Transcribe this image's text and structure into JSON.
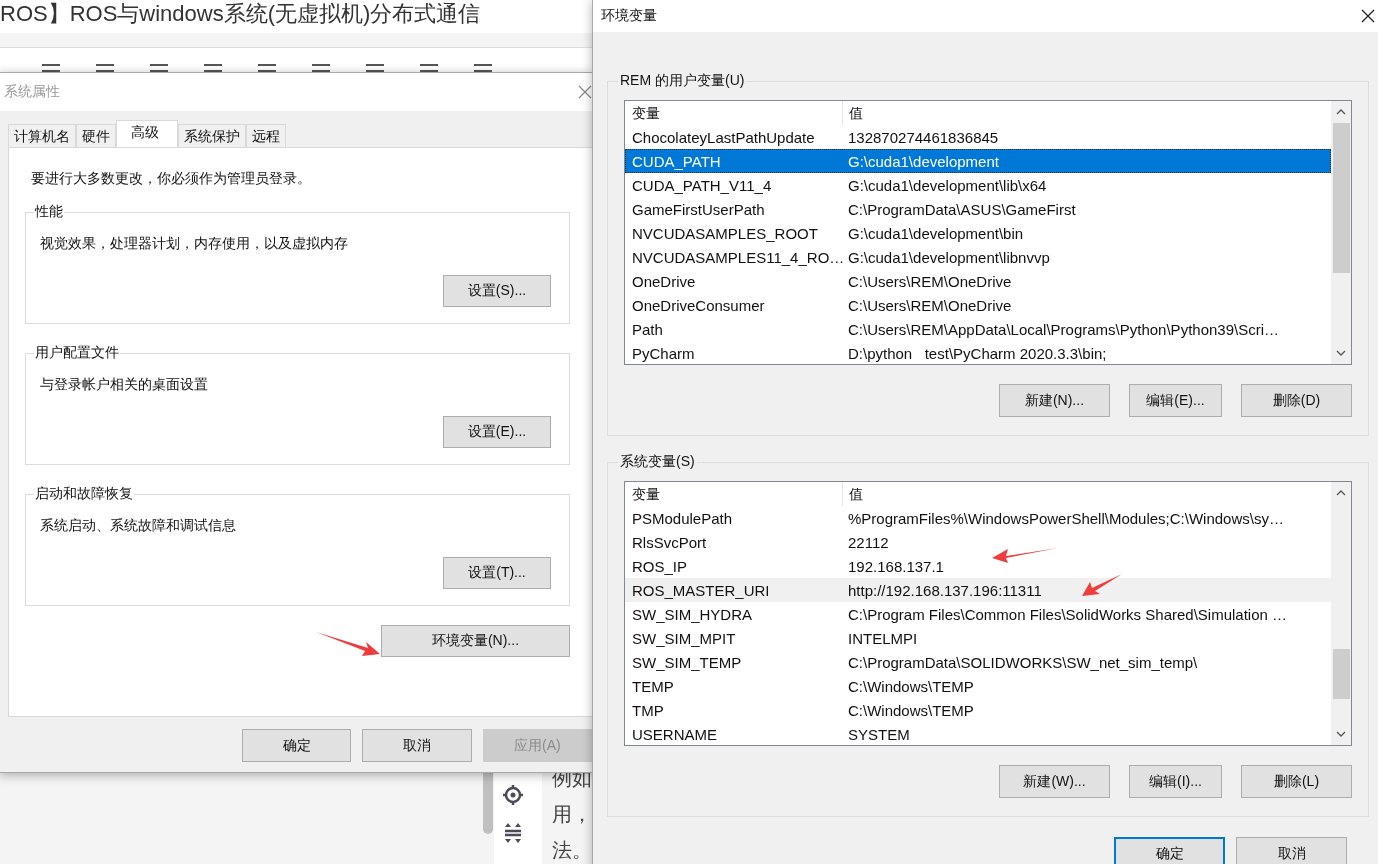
{
  "background_page": {
    "title": "ROS】ROS与windows系统(无虚拟机)分布式通信",
    "text_fragments": [
      "例如",
      "用，",
      "法。"
    ]
  },
  "system_properties": {
    "title": "系统属性",
    "tabs": [
      {
        "label": "计算机名",
        "selected": false
      },
      {
        "label": "硬件",
        "selected": false
      },
      {
        "label": "高级",
        "selected": true
      },
      {
        "label": "系统保护",
        "selected": false
      },
      {
        "label": "远程",
        "selected": false
      }
    ],
    "notice": "要进行大多数更改，你必须作为管理员登录。",
    "groups": [
      {
        "label": "性能",
        "description": "视觉效果，处理器计划，内存使用，以及虚拟内存",
        "button": "设置(S)..."
      },
      {
        "label": "用户配置文件",
        "description": "与登录帐户相关的桌面设置",
        "button": "设置(E)..."
      },
      {
        "label": "启动和故障恢复",
        "description": "系统启动、系统故障和调试信息",
        "button": "设置(T)..."
      }
    ],
    "env_button": "环境变量(N)...",
    "buttons": [
      {
        "label": "确定",
        "disabled": false
      },
      {
        "label": "取消",
        "disabled": false
      },
      {
        "label": "应用(A)",
        "disabled": true
      }
    ]
  },
  "env_vars": {
    "title": "环境变量",
    "sections": [
      {
        "label": "REM 的用户变量(U)",
        "columns": [
          "变量",
          "值"
        ],
        "rows": [
          {
            "name": "ChocolateyLastPathUpdate",
            "value": "132870274461836845",
            "selected": false,
            "hovered": false
          },
          {
            "name": "CUDA_PATH",
            "value": "G:\\cuda1\\development",
            "selected": true,
            "hovered": false
          },
          {
            "name": "CUDA_PATH_V11_4",
            "value": "G:\\cuda1\\development\\lib\\x64",
            "selected": false,
            "hovered": false
          },
          {
            "name": "GameFirstUserPath",
            "value": "C:\\ProgramData\\ASUS\\GameFirst",
            "selected": false,
            "hovered": false
          },
          {
            "name": "NVCUDASAMPLES_ROOT",
            "value": "G:\\cuda1\\development\\bin",
            "selected": false,
            "hovered": false
          },
          {
            "name": "NVCUDASAMPLES11_4_RO…",
            "value": "G:\\cuda1\\development\\libnvvp",
            "selected": false,
            "hovered": false
          },
          {
            "name": "OneDrive",
            "value": "C:\\Users\\REM\\OneDrive",
            "selected": false,
            "hovered": false
          },
          {
            "name": "OneDriveConsumer",
            "value": "C:\\Users\\REM\\OneDrive",
            "selected": false,
            "hovered": false
          },
          {
            "name": "Path",
            "value": "C:\\Users\\REM\\AppData\\Local\\Programs\\Python\\Python39\\Scri…",
            "selected": false,
            "hovered": false
          },
          {
            "name": "PyCharm",
            "value": "D:\\python   test\\PyCharm 2020.3.3\\bin;",
            "selected": false,
            "hovered": false
          }
        ],
        "buttons": [
          "新建(N)...",
          "编辑(E)...",
          "删除(D)"
        ]
      },
      {
        "label": "系统变量(S)",
        "columns": [
          "变量",
          "值"
        ],
        "rows": [
          {
            "name": "PSModulePath",
            "value": "%ProgramFiles%\\WindowsPowerShell\\Modules;C:\\Windows\\sy…",
            "selected": false,
            "hovered": false
          },
          {
            "name": "RlsSvcPort",
            "value": "22112",
            "selected": false,
            "hovered": false
          },
          {
            "name": "ROS_IP",
            "value": "192.168.137.1",
            "selected": false,
            "hovered": false
          },
          {
            "name": "ROS_MASTER_URI",
            "value": "http://192.168.137.196:11311",
            "selected": false,
            "hovered": true
          },
          {
            "name": "SW_SIM_HYDRA",
            "value": "C:\\Program Files\\Common Files\\SolidWorks Shared\\Simulation …",
            "selected": false,
            "hovered": false
          },
          {
            "name": "SW_SIM_MPIT",
            "value": "INTELMPI",
            "selected": false,
            "hovered": false
          },
          {
            "name": "SW_SIM_TEMP",
            "value": "C:\\ProgramData\\SOLIDWORKS\\SW_net_sim_temp\\",
            "selected": false,
            "hovered": false
          },
          {
            "name": "TEMP",
            "value": "C:\\Windows\\TEMP",
            "selected": false,
            "hovered": false
          },
          {
            "name": "TMP",
            "value": "C:\\Windows\\TEMP",
            "selected": false,
            "hovered": false
          },
          {
            "name": "USERNAME",
            "value": "SYSTEM",
            "selected": false,
            "hovered": false
          }
        ],
        "buttons": [
          "新建(W)...",
          "编辑(I)...",
          "删除(L)"
        ]
      }
    ],
    "buttons": [
      {
        "label": "确定",
        "default": true
      },
      {
        "label": "取消",
        "default": false
      }
    ]
  }
}
